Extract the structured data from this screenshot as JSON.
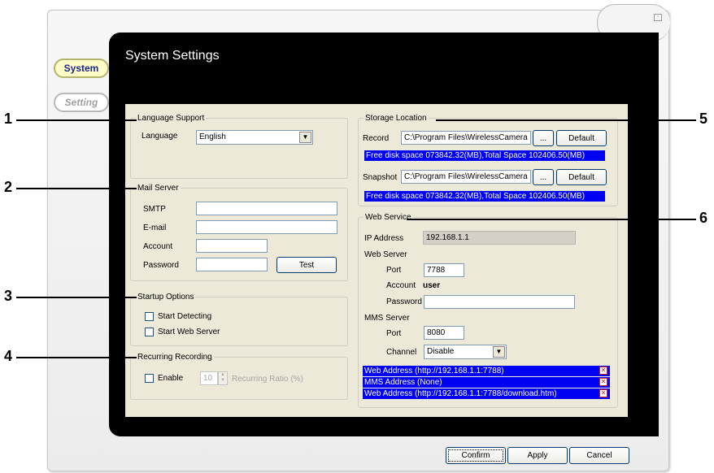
{
  "nav": {
    "system_label": "System",
    "setting_label": "Setting"
  },
  "page_title": "System Settings",
  "language_support": {
    "legend": "Language Support",
    "language_label": "Language",
    "language_value": "English"
  },
  "mail_server": {
    "legend": "Mail Server",
    "smtp_label": "SMTP",
    "email_label": "E-mail",
    "account_label": "Account",
    "password_label": "Password",
    "smtp_value": "",
    "email_value": "",
    "account_value": "",
    "password_value": "",
    "test_label": "Test"
  },
  "startup_options": {
    "legend": "Startup Options",
    "start_detecting_label": "Start Detecting",
    "start_web_server_label": "Start Web Server"
  },
  "recurring_recording": {
    "legend": "Recurring Recording",
    "enable_label": "Enable",
    "ratio_value": "10",
    "ratio_label": "Recurring Ratio (%)"
  },
  "storage_location": {
    "legend": "Storage Location",
    "record_label": "Record",
    "record_path": "C:\\Program Files\\WirelessCamera",
    "record_disk_info": "Free disk space 073842.32(MB),Total Space 102406.50(MB)",
    "snapshot_label": "Snapshot",
    "snapshot_path": "C:\\Program Files\\WirelessCamera",
    "snapshot_disk_info": "Free disk space 073842.32(MB),Total Space 102406.50(MB)",
    "browse_label": "...",
    "default_label": "Default"
  },
  "web_service": {
    "legend": "Web Service",
    "ip_label": "IP Address",
    "ip_value": "192.168.1.1",
    "web_server_label": "Web Server",
    "port_label": "Port",
    "web_port_value": "7788",
    "account_label": "Account",
    "account_value": "user",
    "password_label": "Password",
    "password_value": "",
    "mms_server_label": "MMS Server",
    "mms_port_value": "8080",
    "channel_label": "Channel",
    "channel_value": "Disable",
    "urls": [
      "Web Address  (http://192.168.1.1:7788)",
      "MMS Address (None)",
      "Web Address  (http://192.168.1.1:7788/download.htm)"
    ]
  },
  "footer": {
    "confirm_label": "Confirm",
    "apply_label": "Apply",
    "cancel_label": "Cancel"
  },
  "callouts": [
    "1",
    "2",
    "3",
    "4",
    "5",
    "6"
  ]
}
